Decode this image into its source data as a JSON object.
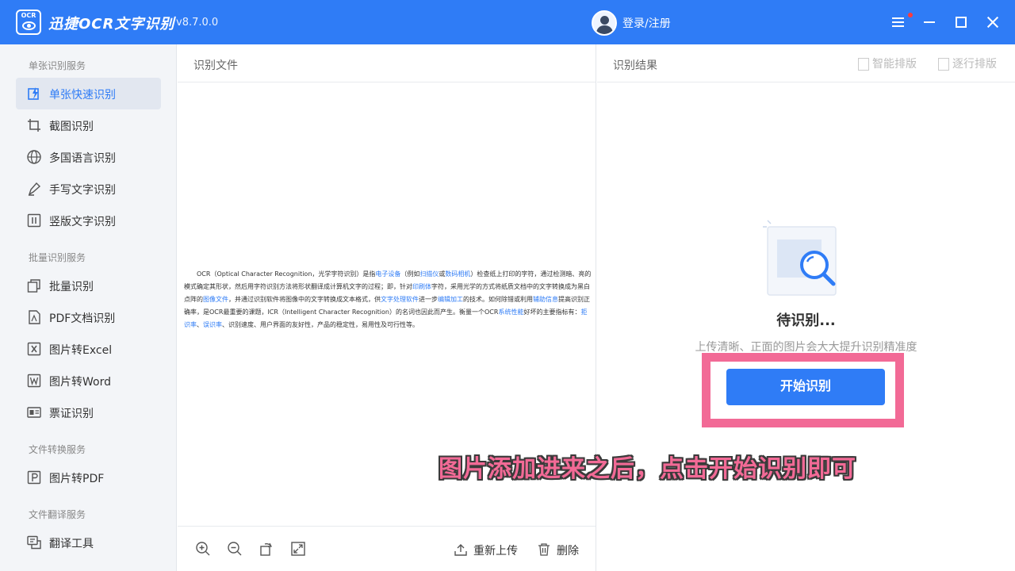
{
  "app": {
    "logo_text": "OCR",
    "name": "迅捷OCR文字识别",
    "version": "v8.7.0.0",
    "login": "登录/注册",
    "brand_color": "#2f7cf6",
    "highlight_color": "#f26a96"
  },
  "sidebar": {
    "sections": [
      {
        "title": "单张识别服务",
        "items": [
          {
            "label": "单张快速识别",
            "icon": "lightning-doc-icon",
            "active": true
          },
          {
            "label": "截图识别",
            "icon": "crop-icon"
          },
          {
            "label": "多国语言识别",
            "icon": "globe-icon"
          },
          {
            "label": "手写文字识别",
            "icon": "pen-icon"
          },
          {
            "label": "竖版文字识别",
            "icon": "vertical-text-icon"
          }
        ]
      },
      {
        "title": "批量识别服务",
        "items": [
          {
            "label": "批量识别",
            "icon": "stack-icon"
          },
          {
            "label": "PDF文档识别",
            "icon": "pdf-icon"
          },
          {
            "label": "图片转Excel",
            "icon": "excel-icon"
          },
          {
            "label": "图片转Word",
            "icon": "word-icon"
          },
          {
            "label": "票证识别",
            "icon": "id-card-icon"
          }
        ]
      },
      {
        "title": "文件转换服务",
        "items": [
          {
            "label": "图片转PDF",
            "icon": "pdf-convert-icon"
          }
        ]
      },
      {
        "title": "文件翻译服务",
        "items": [
          {
            "label": "翻译工具",
            "icon": "translate-icon"
          }
        ]
      }
    ]
  },
  "left_panel": {
    "title": "识别文件",
    "doc": {
      "p1": "OCR（Optical Character Recognition，光学字符识别）是指",
      "l1": "电子设备",
      "p2": "（例如",
      "l2": "扫描仪",
      "p3": "或",
      "l3": "数码相机",
      "p4": "）检查纸上打印的字符，通过检测暗、亮的模式确定其形状，然后用字符识别方法将形状翻译成计算机文字的过程；即，针对",
      "l4": "印刷体",
      "p5": "字符，采用光学的方式将纸质文档中的文字转换成为黑白点阵的",
      "l5": "图像文件",
      "p6": "，并通过识别软件将图像中的文字转换成文本格式，供",
      "l6": "文字处理软件",
      "p7": "进一步",
      "l7": "编辑加工",
      "p8": "的技术。如何除错或利用",
      "l8": "辅助信息",
      "p9": "提高识别正确率，是OCR最重要的课题，ICR（Intelligent Character Recognition）的名词也因此而产生。衡量一个OCR",
      "l9": "系统性能",
      "p10": "好坏的主要指标有：",
      "l10": "拒识率",
      "p11": "、",
      "l11": "误识率",
      "p12": "、识别速度、用户界面的友好性，产品的稳定性，易用性及可行性等。"
    },
    "actions": {
      "reupload": "重新上传",
      "delete": "删除"
    }
  },
  "right_panel": {
    "title": "识别结果",
    "smart_layout": "智能排版",
    "line_layout": "逐行排版",
    "status": "待识别...",
    "hint": "上传清晰、正面的图片会大大提升识别精准度",
    "start_button": "开始识别"
  },
  "annotation": "图片添加进来之后，点击开始识别即可"
}
